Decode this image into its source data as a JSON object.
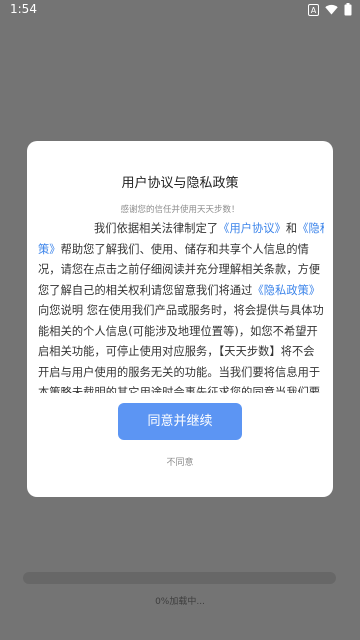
{
  "status_bar": {
    "time": "1:54",
    "icons": [
      "a-notification-icon",
      "wifi-icon",
      "battery-icon"
    ],
    "notification_glyph": "A"
  },
  "dialog": {
    "title": "用户协议与隐私政策",
    "subtitle": "感谢您的信任并使用天天步数！",
    "body_lines": [
      [
        {
          "t": "我们依据相关法律制定了"
        },
        {
          "t": "《用户协议》",
          "link": true
        },
        {
          "t": "和"
        },
        {
          "t": "《隐私政",
          "link": true
        }
      ],
      [
        {
          "t": "策》",
          "link": true
        },
        {
          "t": "帮助您了解我们、使用、储存和共享个人信息的情"
        }
      ],
      [
        {
          "t": "况，请您在点击之前仔细阅读并充分理解相关条款，方便"
        }
      ],
      [
        {
          "t": "您了解自己的相关权利请您留意我们将通过"
        },
        {
          "t": "《隐私政策》",
          "link": true
        }
      ],
      [
        {
          "t": "向您说明 您在使用我们产品或服务时，将会提供与具体功"
        }
      ],
      [
        {
          "t": "能相关的个人信息(可能涉及地理位置等)，如您不希望开"
        }
      ],
      [
        {
          "t": "启相关功能，可停止使用对应服务，【天天步数】将不会"
        }
      ],
      [
        {
          "t": "开启与用户使用的服务无关的功能。当我们要将信息用于"
        }
      ],
      [
        {
          "t": "本策略未载明的其它用途时会事先征求您的同意当我们要"
        }
      ]
    ],
    "agree_label": "同意并继续",
    "disagree_label": "不同意"
  },
  "loading": {
    "progress": 0,
    "label": "0%加载中..."
  },
  "colors": {
    "overlay": "#747474",
    "accent": "#5c95f3",
    "link": "#3a83ea"
  }
}
